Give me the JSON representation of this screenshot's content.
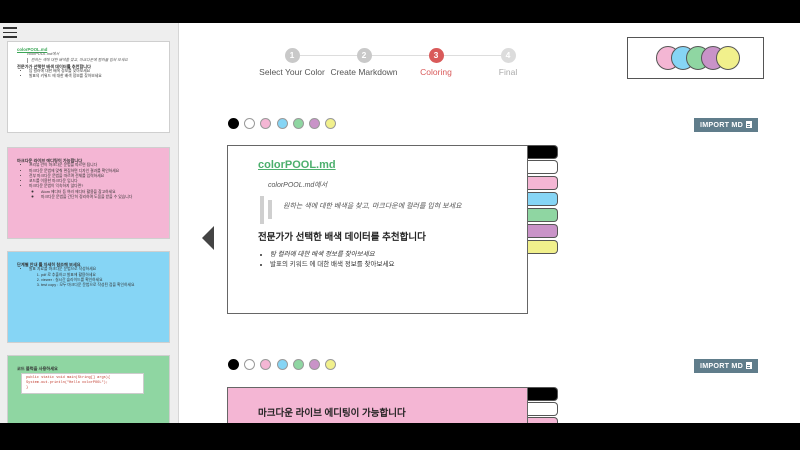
{
  "colors": {
    "black": "#000000",
    "white": "#ffffff",
    "pink": "#f4b6d4",
    "blue": "#86d5f5",
    "green": "#8fd6a2",
    "purple": "#c993c8",
    "yellow": "#f1f08c",
    "accent": "#d95a5a",
    "button": "#607d8b"
  },
  "sidebar": {
    "thumbs": [
      {
        "title": "colorPOOL.md",
        "text": "colorPOOL.md에서",
        "quote": "원하는 색에 대한 배색을 찾고, 마크다운에 컬러를 입혀 보세요",
        "heading": "전문가가 선택한 배색 데이터를 추천합니다",
        "items": [
          "탐 컬러에 대한 배색 정보를 찾아보세요",
          "발표의 키워드 에 대한 배색 정보를 찾아보세요"
        ]
      },
      {
        "heading": "마크다운 라이브 에디팅이 가능합니다",
        "items": [
          "프리뷰 란이 마크다운 문법을 따르면 됩니다",
          "마크다운 문법에 맞춰 편집하면 디자인 결과를 확인하세요",
          "전부 마크다운 문법을 따르며 전체를 입력하세요",
          "코드를 이용한 마크다운 입니다",
          "마크다운 문법이 익숙하지 않다면?"
        ],
        "sub": [
          "Atom 에디터 등 여러 에디터 활용을 참고하세요",
          "마크다운 문법을 간단히 정리하며 도움을 받을 수 있습니다"
        ]
      },
      {
        "heading": "단계별 안내 를 자세히 참조해 보세요",
        "items": [
          "발표 자료를 마크다운 문법으로 작성하세요",
          "pdf 로 추출하고 발표에 활용하세요",
          "viewer : 실시간 슬라이드를 확인하세요",
          "test copy : 모두 마크다운 문법으로 작성된 점을 확인하세요"
        ]
      },
      {
        "heading": "코드 블럭을 사용하세요",
        "code": [
          "public static void main(String[] args){",
          "  System.out.println(\"Hello colorPOOL\");",
          "}"
        ]
      }
    ]
  },
  "stepper": {
    "steps": [
      {
        "num": "1",
        "label": "Select Your Color"
      },
      {
        "num": "2",
        "label": "Create Markdown"
      },
      {
        "num": "3",
        "label": "Coloring"
      },
      {
        "num": "4",
        "label": "Final"
      }
    ]
  },
  "import_label": "IMPORT MD",
  "slides": [
    {
      "title": "colorPOOL.md",
      "text": "colorPOOL.md에서",
      "quote": "원하는 색에 대한 배색을 찾고, 마크다운에 컬러를 입혀 보세요",
      "heading": "전문가가 선택한 배색 데이터를 추천합니다",
      "items": [
        "탐 컬러에 대한 배색 정보를 찾아보세요",
        "발표의 키워드 에 대한 배색 정보를 찾아보세요"
      ]
    },
    {
      "heading": "마크다운 라이브 에디팅이 가능합니다"
    }
  ],
  "icons": {
    "menu": "hamburger-menu-icon",
    "prev": "left-triangle-icon",
    "doc": "document-icon"
  }
}
